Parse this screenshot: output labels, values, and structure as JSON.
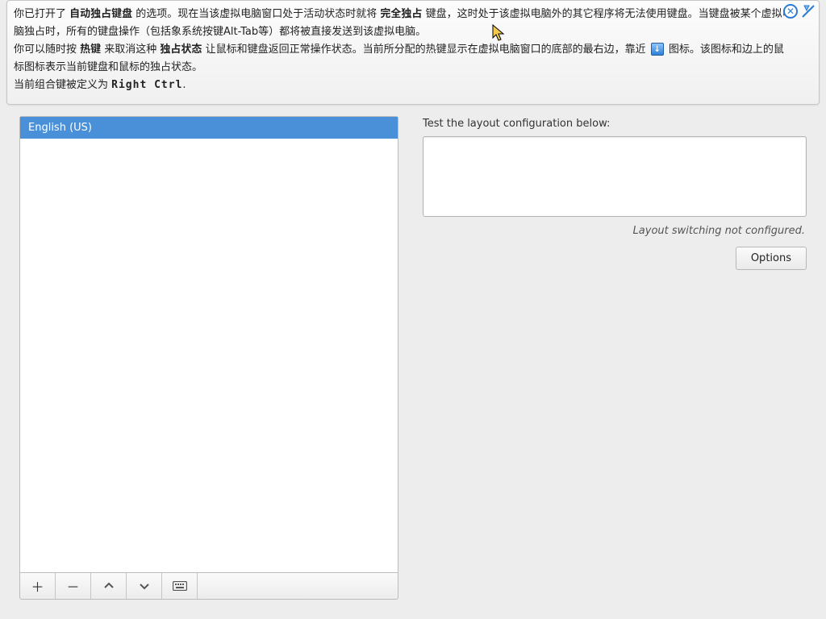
{
  "notice": {
    "p1_a": "你已打开了 ",
    "p1_b": "自动独占键盘",
    "p1_c": " 的选项。现在当该虚拟电脑窗口处于活动状态时就将 ",
    "p1_d": "完全独占",
    "p1_e": " 键盘，这时处于该虚拟电脑外的其它程序将无法使用键盘。当键盘被某个虚拟电脑独占时，所有的键盘操作（包括象系统按键Alt-Tab等）都将被直接发送到该虚拟电脑。",
    "p2_a": "你可以随时按 ",
    "p2_b": "热键",
    "p2_c": " 来取消这种 ",
    "p2_d": "独占状态",
    "p2_e": " 让鼠标和键盘返回正常操作状态。当前所分配的热键显示在虚拟电脑窗口的底部的最右边，靠近 ",
    "p2_f": " 图标。该图标和边上的鼠标图标表示当前键盘和鼠标的独占状态。",
    "p3_a": "当前组合键被定义为 ",
    "p3_b": "Right Ctrl",
    "p3_c": "."
  },
  "layouts": {
    "items": [
      "English (US)"
    ]
  },
  "right": {
    "test_label": "Test the layout configuration below:",
    "switch_note": "Layout switching not configured.",
    "options_btn": "Options"
  },
  "icons": {
    "add": "＋",
    "remove": "－"
  }
}
